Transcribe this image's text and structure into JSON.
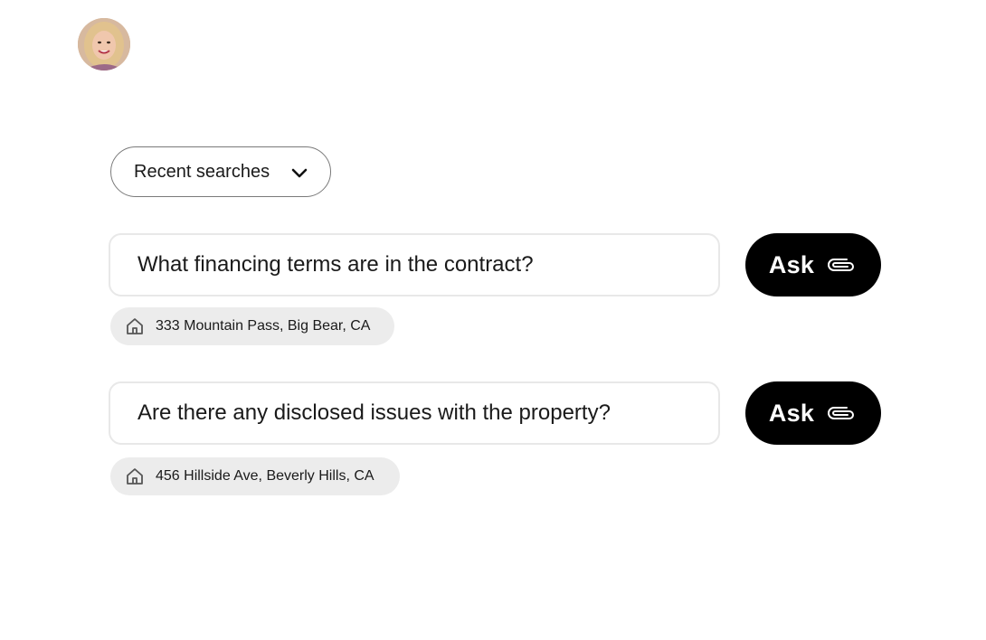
{
  "user": {
    "avatar_icon": "user-avatar-photo"
  },
  "recent_searches": {
    "label": "Recent searches",
    "icon": "chevron-down-icon"
  },
  "queries": [
    {
      "question": "What financing terms are in the contract?",
      "ask_label": "Ask",
      "ask_icon": "paperclip-icon",
      "address": "333 Mountain Pass, Big Bear, CA",
      "address_icon": "home-icon"
    },
    {
      "question": "Are there any disclosed issues with the property?",
      "ask_label": "Ask",
      "ask_icon": "paperclip-icon",
      "address": "456 Hillside Ave, Beverly Hills, CA",
      "address_icon": "home-icon"
    }
  ],
  "colors": {
    "button_bg": "#000000",
    "chip_bg": "#ececec",
    "input_border": "#e8e8e8",
    "dropdown_border": "#7a7a7a"
  }
}
